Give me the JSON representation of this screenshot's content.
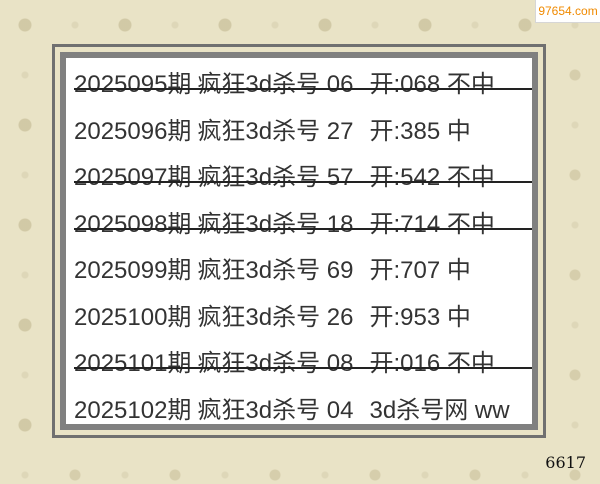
{
  "watermark": "97654.com",
  "counter": "6617",
  "rows": [
    {
      "period": "2025095期",
      "kill": "疯狂3d杀号 06",
      "result": "开:068 不中",
      "status": "miss"
    },
    {
      "period": "2025096期",
      "kill": "疯狂3d杀号 27",
      "result": "开:385 中",
      "status": "hit"
    },
    {
      "period": "2025097期",
      "kill": "疯狂3d杀号 57",
      "result": "开:542 不中",
      "status": "miss"
    },
    {
      "period": "2025098期",
      "kill": "疯狂3d杀号 18",
      "result": "开:714 不中",
      "status": "miss"
    },
    {
      "period": "2025099期",
      "kill": "疯狂3d杀号 69",
      "result": "开:707 中",
      "status": "hit"
    },
    {
      "period": "2025100期",
      "kill": "疯狂3d杀号 26",
      "result": "开:953 中",
      "status": "hit"
    },
    {
      "period": "2025101期",
      "kill": "疯狂3d杀号 08",
      "result": "开:016 不中",
      "status": "miss"
    },
    {
      "period": "2025102期",
      "kill": "疯狂3d杀号 04",
      "result": "3d杀号网 ww",
      "status": "pending"
    }
  ]
}
